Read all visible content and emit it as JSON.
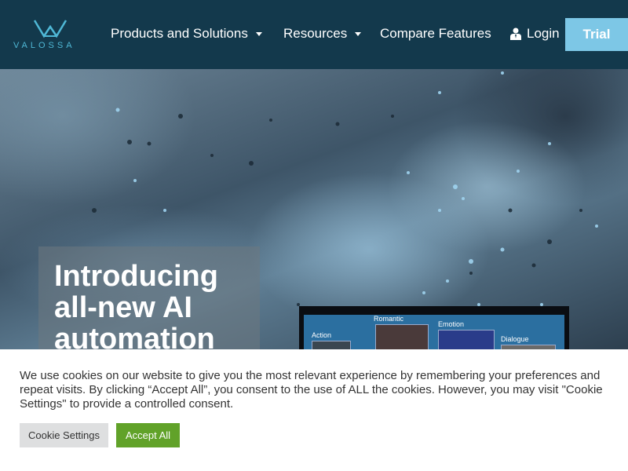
{
  "header": {
    "logo_text": "VALOSSA",
    "nav": [
      {
        "label": "Products and Solutions",
        "has_dropdown": true
      },
      {
        "label": "Resources",
        "has_dropdown": true
      },
      {
        "label": "Compare Features",
        "has_dropdown": false
      }
    ],
    "login_label": "Login",
    "trial_label": "Trial"
  },
  "hero": {
    "title_lines": [
      "Introducing",
      "all-new AI",
      "automation"
    ],
    "preview_labels": [
      "Action",
      "Romantic",
      "Emotion",
      "Dialogue"
    ]
  },
  "cookie_banner": {
    "text": "We use cookies on our website to give you the most relevant experience by remembering your preferences and repeat visits. By clicking “Accept All”, you consent to the use of ALL the cookies. However, you may visit \"Cookie Settings\" to provide a controlled consent.",
    "settings_label": "Cookie Settings",
    "accept_label": "Accept All"
  },
  "colors": {
    "header_bg": "#13394c",
    "accent": "#4fb8d6",
    "trial_button": "#7dc7e6",
    "accept_button": "#61a229"
  }
}
